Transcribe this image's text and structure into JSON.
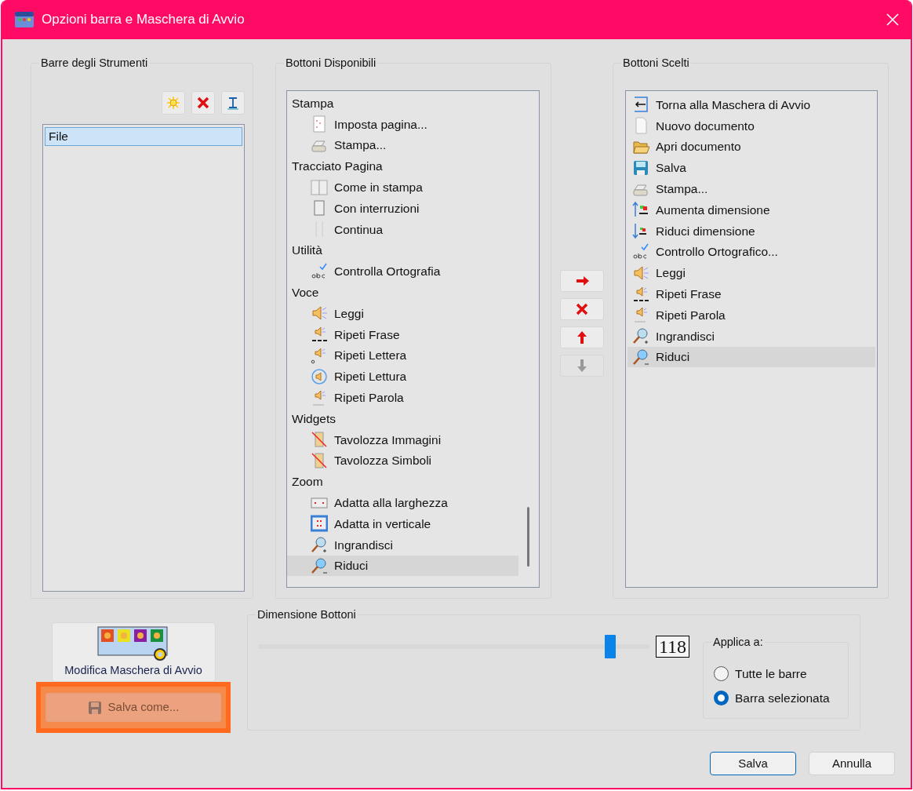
{
  "window": {
    "title": "Opzioni barra e Maschera di Avvio"
  },
  "toolbars": {
    "title": "Barre degli Strumenti",
    "items": [
      {
        "label": "File",
        "selected": true
      }
    ]
  },
  "available": {
    "title": "Bottoni Disponibili",
    "groups": [
      {
        "label": "Stampa",
        "children": [
          {
            "label": "Imposta pagina...",
            "selected": false
          },
          {
            "label": "Stampa...",
            "selected": false
          }
        ]
      },
      {
        "label": "Tracciato Pagina",
        "children": [
          {
            "label": "Come in stampa",
            "selected": false
          },
          {
            "label": "Con interruzioni",
            "selected": false
          },
          {
            "label": "Continua",
            "selected": false
          }
        ]
      },
      {
        "label": "Utilità",
        "children": [
          {
            "label": "Controlla Ortografia",
            "selected": false
          }
        ]
      },
      {
        "label": "Voce",
        "children": [
          {
            "label": "Leggi",
            "selected": false
          },
          {
            "label": "Ripeti Frase",
            "selected": false
          },
          {
            "label": "Ripeti Lettera",
            "selected": false
          },
          {
            "label": "Ripeti Lettura",
            "selected": false
          },
          {
            "label": "Ripeti Parola",
            "selected": false
          }
        ]
      },
      {
        "label": "Widgets",
        "children": [
          {
            "label": "Tavolozza Immagini",
            "selected": false
          },
          {
            "label": "Tavolozza Simboli",
            "selected": false
          }
        ]
      },
      {
        "label": "Zoom",
        "children": [
          {
            "label": "Adatta alla larghezza",
            "selected": false
          },
          {
            "label": "Adatta in verticale",
            "selected": false
          },
          {
            "label": "Ingrandisci",
            "selected": false
          },
          {
            "label": "Riduci",
            "selected": true
          }
        ]
      }
    ]
  },
  "move_buttons": [
    {
      "disabled": false
    },
    {
      "disabled": false
    },
    {
      "disabled": false
    },
    {
      "disabled": true
    }
  ],
  "chosen": {
    "title": "Bottoni Scelti",
    "items": [
      {
        "label": "Torna alla Maschera di Avvio",
        "selected": false
      },
      {
        "label": "Nuovo documento",
        "selected": false
      },
      {
        "label": "Apri documento",
        "selected": false
      },
      {
        "label": "Salva",
        "selected": false
      },
      {
        "label": "Stampa...",
        "selected": false
      },
      {
        "label": "Aumenta dimensione",
        "selected": false
      },
      {
        "label": "Riduci dimensione",
        "selected": false
      },
      {
        "label": "Controllo Ortografico...",
        "selected": false
      },
      {
        "label": "Leggi",
        "selected": false
      },
      {
        "label": "Ripeti Frase",
        "selected": false
      },
      {
        "label": "Ripeti Parola",
        "selected": false
      },
      {
        "label": "Ingrandisci",
        "selected": false
      },
      {
        "label": "Riduci",
        "selected": true
      }
    ]
  },
  "startup_mask": {
    "label": "Modifica Maschera di Avvio"
  },
  "save_as": {
    "label": "Salva come...",
    "highlighted": true
  },
  "button_size": {
    "title": "Dimensione Bottoni",
    "level": 0.9,
    "value": "118",
    "apply_to": {
      "label": "Applica a:",
      "options": [
        {
          "label": "Tutte le barre",
          "selected": false
        },
        {
          "label": "Barra selezionata",
          "selected": true
        }
      ]
    }
  },
  "footer_buttons": [
    {
      "label": "Salva",
      "kind": "default"
    },
    {
      "label": "Annulla",
      "kind": "normal"
    }
  ]
}
